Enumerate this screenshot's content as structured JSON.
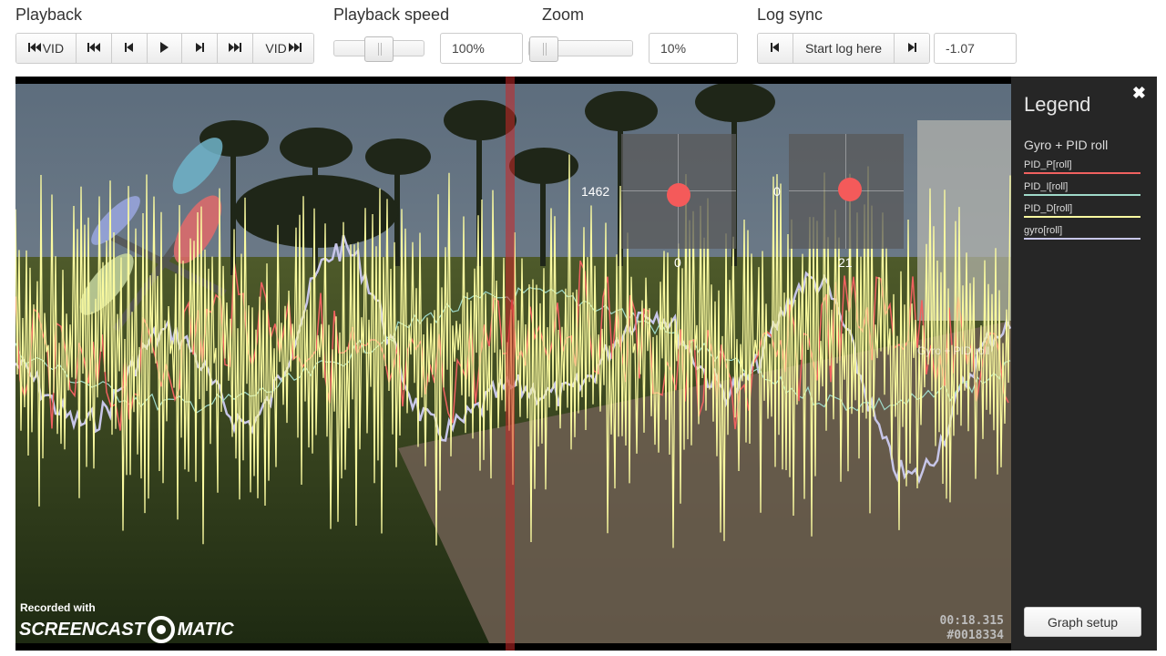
{
  "toolbar": {
    "playback_label": "Playback",
    "playback_speed_label": "Playback speed",
    "zoom_label": "Zoom",
    "log_sync_label": "Log sync",
    "vid_start_label": "VID",
    "vid_end_label": "VID",
    "speed_value": "100%",
    "zoom_value": "10%",
    "start_log_here_label": "Start log here",
    "log_offset_value": "-1.07",
    "speed_slider_level": 0.5,
    "zoom_slider_level": 0.0
  },
  "sticks": {
    "left_top_value": "1462",
    "left_bottom_value": "0",
    "right_top_value": "0",
    "right_bottom_value": "21"
  },
  "overlay": {
    "recorded_with": "Recorded with",
    "brand": "SCREENCAST",
    "brand_suffix": "MATIC",
    "graph_label": "Gyro + PID roll",
    "time": "00:18.315",
    "frame": "#0018334"
  },
  "legend": {
    "title": "Legend",
    "subtitle": "Gyro + PID roll",
    "items": [
      {
        "label": "PID_P[roll]",
        "color": "#f0615f"
      },
      {
        "label": "PID_I[roll]",
        "color": "#9fd9c9"
      },
      {
        "label": "PID_D[roll]",
        "color": "#fbfba0"
      },
      {
        "label": "gyro[roll]",
        "color": "#c7c6e9"
      }
    ],
    "graph_setup_label": "Graph setup"
  },
  "colors": {
    "accent_red": "#f45a5a",
    "legend_bg": "#262626"
  }
}
